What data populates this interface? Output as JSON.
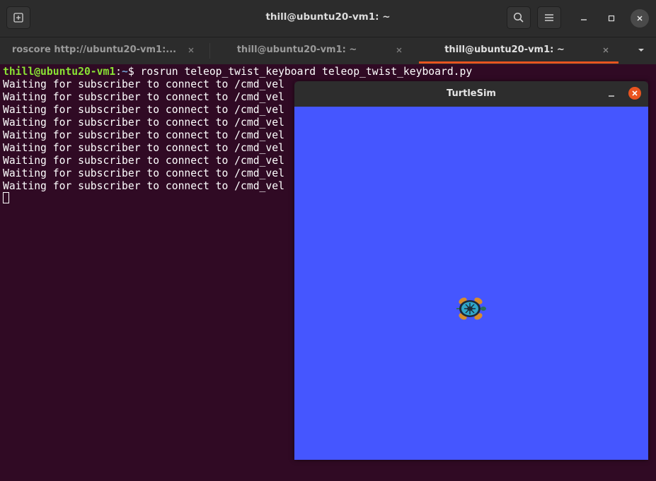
{
  "window": {
    "title": "thill@ubuntu20-vm1: ~"
  },
  "icons": {
    "new_tab": "new-tab-icon",
    "search": "search-icon",
    "menu": "hamburger-menu-icon",
    "minimize": "minimize-icon",
    "maximize": "maximize-icon",
    "close": "close-icon",
    "tab_dropdown": "chevron-down-icon"
  },
  "tabs": [
    {
      "label": "roscore http://ubuntu20-vm1:...",
      "active": false
    },
    {
      "label": "thill@ubuntu20-vm1: ~",
      "active": false
    },
    {
      "label": "thill@ubuntu20-vm1: ~",
      "active": true
    }
  ],
  "terminal": {
    "prompt_user": "thill@ubuntu20-vm1",
    "prompt_sep": ":",
    "prompt_path": "~",
    "prompt_symbol": "$ ",
    "command": "rosrun teleop_twist_keyboard teleop_twist_keyboard.py",
    "output_lines": [
      "Waiting for subscriber to connect to /cmd_vel",
      "Waiting for subscriber to connect to /cmd_vel",
      "Waiting for subscriber to connect to /cmd_vel",
      "Waiting for subscriber to connect to /cmd_vel",
      "Waiting for subscriber to connect to /cmd_vel",
      "Waiting for subscriber to connect to /cmd_vel",
      "Waiting for subscriber to connect to /cmd_vel",
      "Waiting for subscriber to connect to /cmd_vel",
      "Waiting for subscriber to connect to /cmd_vel"
    ]
  },
  "turtlesim": {
    "title": "TurtleSim",
    "background_color": "#4556ff"
  },
  "colors": {
    "terminal_bg": "#300a24",
    "accent": "#e95420",
    "prompt_user": "#8ae234",
    "prompt_path": "#729fcf"
  }
}
